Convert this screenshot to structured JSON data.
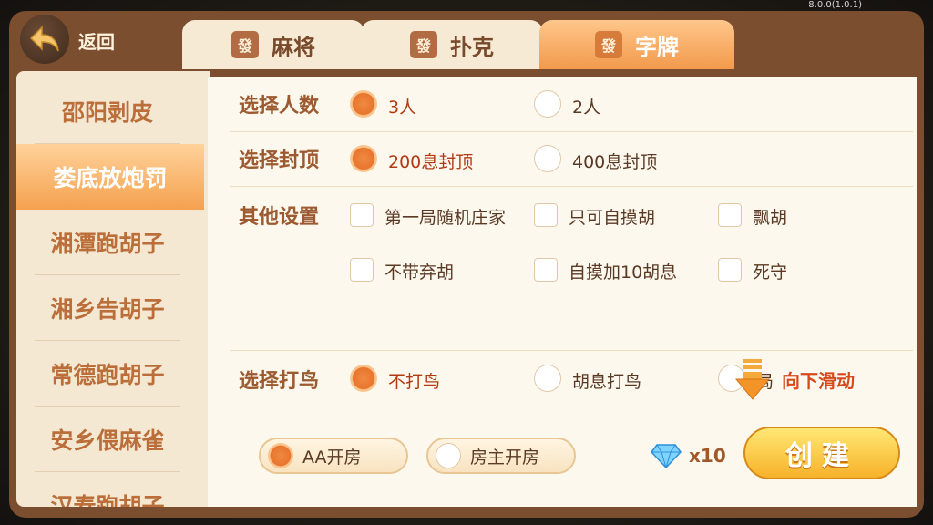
{
  "version": "8.0.0(1.0.1)",
  "back_label": "返回",
  "tabs": [
    {
      "tile": "發",
      "label": "麻将"
    },
    {
      "tile": "發",
      "label": "扑克"
    },
    {
      "tile": "發",
      "label": "字牌"
    }
  ],
  "sidebar": {
    "items": [
      "邵阳剥皮",
      "娄底放炮罚",
      "湘潭跑胡子",
      "湘乡告胡子",
      "常德跑胡子",
      "安乡偎麻雀",
      "汉寿跑胡子"
    ],
    "selected": "娄底放炮罚"
  },
  "players": {
    "label": "选择人数",
    "options": [
      "3人",
      "2人"
    ],
    "selected": "3人"
  },
  "cap": {
    "label": "选择封顶",
    "options": [
      "200息封顶",
      "400息封顶"
    ],
    "selected": "200息封顶"
  },
  "other": {
    "label": "其他设置",
    "options": [
      "第一局随机庄家",
      "只可自摸胡",
      "飘胡",
      "不带弃胡",
      "自摸加10胡息",
      "死守"
    ]
  },
  "bird": {
    "label": "选择打鸟",
    "options": [
      "不打鸟",
      "胡息打鸟",
      "局"
    ],
    "selected": "不打鸟"
  },
  "scroll_hint": "向下滑动",
  "room": {
    "options": [
      "AA开房",
      "房主开房"
    ],
    "selected": "AA开房"
  },
  "cost": "x10",
  "create_label": "创建",
  "colors": {
    "accent": "#f08a42",
    "frame": "#7a4e2f",
    "panel": "#fdf8ee"
  }
}
